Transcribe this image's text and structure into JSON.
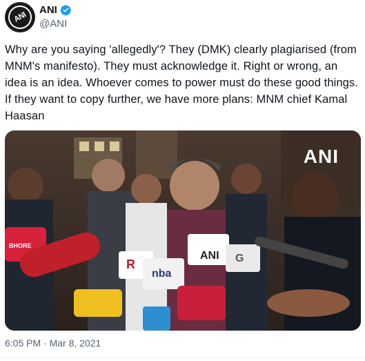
{
  "author": {
    "display_name": "ANI",
    "handle": "@ANI",
    "avatar_icon": "ani-logo-avatar",
    "avatar_text": "ANI",
    "verified": true,
    "verified_color": "#1d9bf0"
  },
  "tweet": {
    "text": "Why are you saying 'allegedly'? They (DMK) clearly plagiarised (from MNM's manifesto). They must acknowledge it. Right or wrong, an idea is an idea. Whoever comes to power must do these good things. If they want to copy further, we have more plans: MNM chief Kamal Haasan",
    "timestamp": "6:05 PM · Mar 8, 2021"
  },
  "media": {
    "watermark": "ANI",
    "description_icon": "press-photo",
    "mic_labels": [
      "ANI",
      "nba",
      "R",
      "G",
      "BHORE"
    ]
  }
}
